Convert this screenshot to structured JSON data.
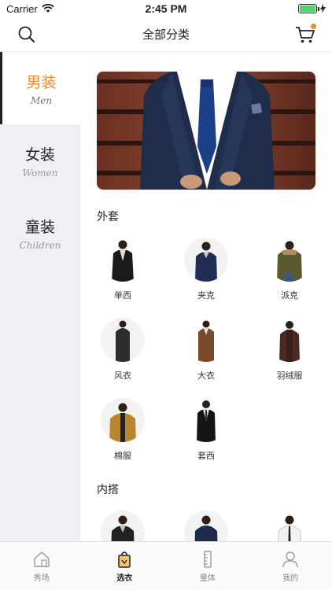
{
  "status": {
    "carrier": "Carrier",
    "time": "2:45 PM",
    "battery_level": 1.0
  },
  "header": {
    "title": "全部分类",
    "left_icon": "search-icon",
    "right_icon": "cart-icon",
    "cart_badge_color": "#f08a24"
  },
  "sidebar": {
    "accent_color": "#f08a24",
    "items": [
      {
        "cn": "男装",
        "en": "Men",
        "active": true
      },
      {
        "cn": "女装",
        "en": "Women",
        "active": false
      },
      {
        "cn": "童装",
        "en": "Children",
        "active": false
      }
    ]
  },
  "sections": [
    {
      "title": "外套",
      "items": [
        "单西",
        "夹克",
        "派克",
        "风衣",
        "大衣",
        "羽绒服",
        "棉服",
        "套西"
      ]
    },
    {
      "title": "内搭",
      "items": []
    }
  ],
  "tabbar": {
    "items": [
      {
        "label": "秀场",
        "icon": "home-icon",
        "active": false
      },
      {
        "label": "选衣",
        "icon": "shopping-bag-icon",
        "active": true
      },
      {
        "label": "量体",
        "icon": "ruler-icon",
        "active": false
      },
      {
        "label": "我的",
        "icon": "user-icon",
        "active": false
      }
    ]
  }
}
